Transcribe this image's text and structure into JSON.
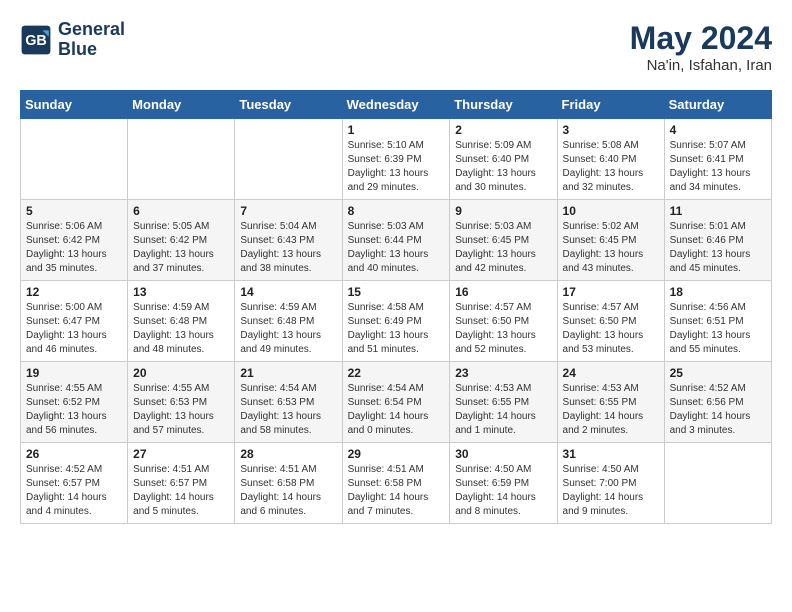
{
  "header": {
    "logo_line1": "General",
    "logo_line2": "Blue",
    "month": "May 2024",
    "location": "Na'in, Isfahan, Iran"
  },
  "weekdays": [
    "Sunday",
    "Monday",
    "Tuesday",
    "Wednesday",
    "Thursday",
    "Friday",
    "Saturday"
  ],
  "weeks": [
    [
      {
        "day": "",
        "info": ""
      },
      {
        "day": "",
        "info": ""
      },
      {
        "day": "",
        "info": ""
      },
      {
        "day": "1",
        "info": "Sunrise: 5:10 AM\nSunset: 6:39 PM\nDaylight: 13 hours\nand 29 minutes."
      },
      {
        "day": "2",
        "info": "Sunrise: 5:09 AM\nSunset: 6:40 PM\nDaylight: 13 hours\nand 30 minutes."
      },
      {
        "day": "3",
        "info": "Sunrise: 5:08 AM\nSunset: 6:40 PM\nDaylight: 13 hours\nand 32 minutes."
      },
      {
        "day": "4",
        "info": "Sunrise: 5:07 AM\nSunset: 6:41 PM\nDaylight: 13 hours\nand 34 minutes."
      }
    ],
    [
      {
        "day": "5",
        "info": "Sunrise: 5:06 AM\nSunset: 6:42 PM\nDaylight: 13 hours\nand 35 minutes."
      },
      {
        "day": "6",
        "info": "Sunrise: 5:05 AM\nSunset: 6:42 PM\nDaylight: 13 hours\nand 37 minutes."
      },
      {
        "day": "7",
        "info": "Sunrise: 5:04 AM\nSunset: 6:43 PM\nDaylight: 13 hours\nand 38 minutes."
      },
      {
        "day": "8",
        "info": "Sunrise: 5:03 AM\nSunset: 6:44 PM\nDaylight: 13 hours\nand 40 minutes."
      },
      {
        "day": "9",
        "info": "Sunrise: 5:03 AM\nSunset: 6:45 PM\nDaylight: 13 hours\nand 42 minutes."
      },
      {
        "day": "10",
        "info": "Sunrise: 5:02 AM\nSunset: 6:45 PM\nDaylight: 13 hours\nand 43 minutes."
      },
      {
        "day": "11",
        "info": "Sunrise: 5:01 AM\nSunset: 6:46 PM\nDaylight: 13 hours\nand 45 minutes."
      }
    ],
    [
      {
        "day": "12",
        "info": "Sunrise: 5:00 AM\nSunset: 6:47 PM\nDaylight: 13 hours\nand 46 minutes."
      },
      {
        "day": "13",
        "info": "Sunrise: 4:59 AM\nSunset: 6:48 PM\nDaylight: 13 hours\nand 48 minutes."
      },
      {
        "day": "14",
        "info": "Sunrise: 4:59 AM\nSunset: 6:48 PM\nDaylight: 13 hours\nand 49 minutes."
      },
      {
        "day": "15",
        "info": "Sunrise: 4:58 AM\nSunset: 6:49 PM\nDaylight: 13 hours\nand 51 minutes."
      },
      {
        "day": "16",
        "info": "Sunrise: 4:57 AM\nSunset: 6:50 PM\nDaylight: 13 hours\nand 52 minutes."
      },
      {
        "day": "17",
        "info": "Sunrise: 4:57 AM\nSunset: 6:50 PM\nDaylight: 13 hours\nand 53 minutes."
      },
      {
        "day": "18",
        "info": "Sunrise: 4:56 AM\nSunset: 6:51 PM\nDaylight: 13 hours\nand 55 minutes."
      }
    ],
    [
      {
        "day": "19",
        "info": "Sunrise: 4:55 AM\nSunset: 6:52 PM\nDaylight: 13 hours\nand 56 minutes."
      },
      {
        "day": "20",
        "info": "Sunrise: 4:55 AM\nSunset: 6:53 PM\nDaylight: 13 hours\nand 57 minutes."
      },
      {
        "day": "21",
        "info": "Sunrise: 4:54 AM\nSunset: 6:53 PM\nDaylight: 13 hours\nand 58 minutes."
      },
      {
        "day": "22",
        "info": "Sunrise: 4:54 AM\nSunset: 6:54 PM\nDaylight: 14 hours\nand 0 minutes."
      },
      {
        "day": "23",
        "info": "Sunrise: 4:53 AM\nSunset: 6:55 PM\nDaylight: 14 hours\nand 1 minute."
      },
      {
        "day": "24",
        "info": "Sunrise: 4:53 AM\nSunset: 6:55 PM\nDaylight: 14 hours\nand 2 minutes."
      },
      {
        "day": "25",
        "info": "Sunrise: 4:52 AM\nSunset: 6:56 PM\nDaylight: 14 hours\nand 3 minutes."
      }
    ],
    [
      {
        "day": "26",
        "info": "Sunrise: 4:52 AM\nSunset: 6:57 PM\nDaylight: 14 hours\nand 4 minutes."
      },
      {
        "day": "27",
        "info": "Sunrise: 4:51 AM\nSunset: 6:57 PM\nDaylight: 14 hours\nand 5 minutes."
      },
      {
        "day": "28",
        "info": "Sunrise: 4:51 AM\nSunset: 6:58 PM\nDaylight: 14 hours\nand 6 minutes."
      },
      {
        "day": "29",
        "info": "Sunrise: 4:51 AM\nSunset: 6:58 PM\nDaylight: 14 hours\nand 7 minutes."
      },
      {
        "day": "30",
        "info": "Sunrise: 4:50 AM\nSunset: 6:59 PM\nDaylight: 14 hours\nand 8 minutes."
      },
      {
        "day": "31",
        "info": "Sunrise: 4:50 AM\nSunset: 7:00 PM\nDaylight: 14 hours\nand 9 minutes."
      },
      {
        "day": "",
        "info": ""
      }
    ]
  ]
}
